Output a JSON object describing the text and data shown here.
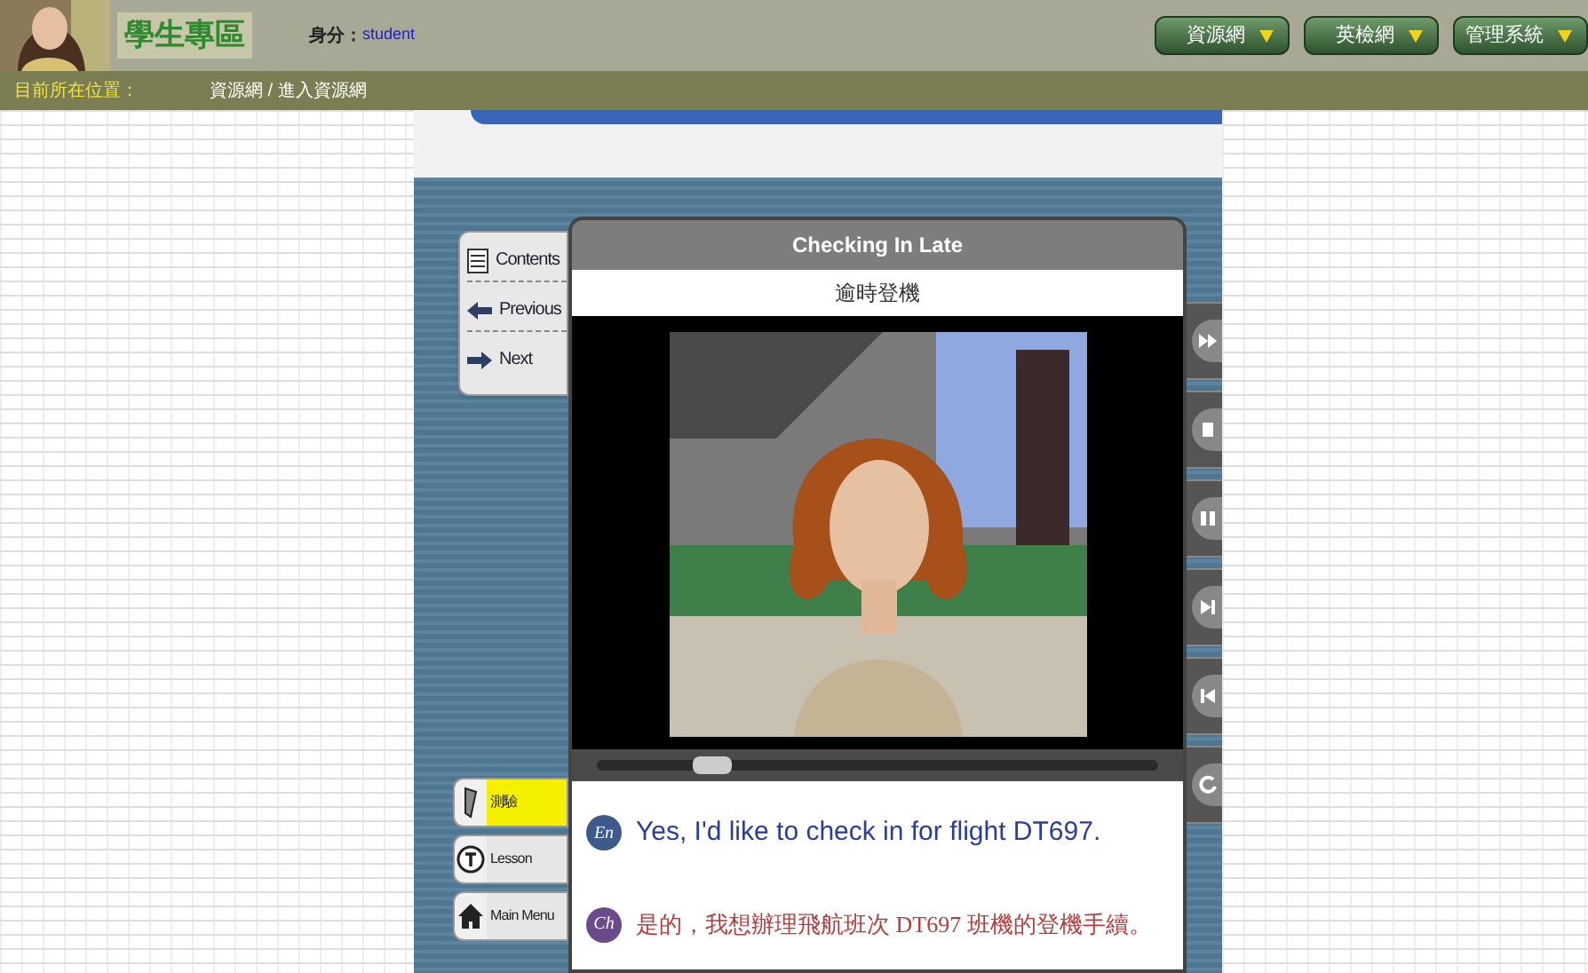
{
  "header": {
    "logo_text": "學生專區",
    "identity_label": "身分：",
    "identity_value": "student",
    "menu_buttons": [
      "資源網",
      "英檢網",
      "管理系統"
    ]
  },
  "breadcrumb": {
    "label": "目前所在位置：",
    "path": "資源網 / 進入資源網"
  },
  "nav": [
    "Contents",
    "Previous",
    "Next"
  ],
  "player": {
    "title": "Checking In Late",
    "subtitle": "逾時登機",
    "progress": {
      "level": 0.17
    },
    "lines": [
      {
        "tag": "En",
        "text": "Yes, I'd like to check in for flight DT697.",
        "kind": "english"
      },
      {
        "tag": "Ch",
        "text": "是的，我想辦理飛航班次 DT697 班機的登機手續。",
        "kind": "chinese"
      }
    ]
  },
  "media_controls": [
    {
      "kind": "fast_forward"
    },
    {
      "kind": "stop"
    },
    {
      "kind": "pause"
    },
    {
      "kind": "next"
    },
    {
      "kind": "previous"
    },
    {
      "kind": "replay"
    }
  ],
  "mode_buttons": [
    {
      "label": "測驗",
      "kind": "quiz",
      "selected": true
    },
    {
      "label": "Lesson",
      "kind": "lesson",
      "selected": false
    },
    {
      "label": "Main Menu",
      "kind": "home",
      "selected": false
    }
  ]
}
